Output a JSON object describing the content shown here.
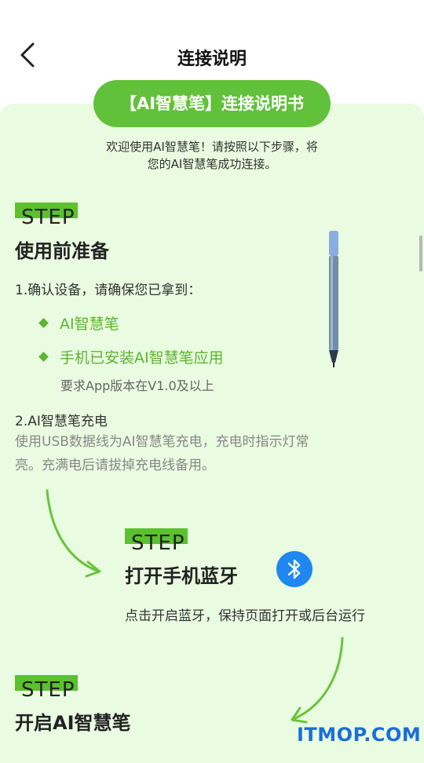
{
  "header": {
    "title": "连接说明"
  },
  "banner": {
    "label": "【AI智慧笔】连接说明书"
  },
  "intro": {
    "line1": "欢迎使用AI智慧笔！请按照以下步骤，将",
    "line2": "您的AI智慧笔成功连接。"
  },
  "step1": {
    "tag": "STEP",
    "title": "使用前准备",
    "item1": "1.确认设备，请确保您已拿到：",
    "bullet1": "AI智慧笔",
    "bullet2": "手机已安装AI智慧笔应用",
    "note": "要求App版本在V1.0及以上",
    "item2": "2.AI智慧笔充电",
    "desc_line1": "使用USB数据线为AI智慧笔充电，充电时指示灯常",
    "desc_line2": "亮。充满电后请拔掉充电线备用。"
  },
  "step2": {
    "tag": "STEP",
    "title": "打开手机蓝牙",
    "desc": "点击开启蓝牙，保持页面打开或后台运行"
  },
  "step3": {
    "tag": "STEP",
    "title": "开启AI智慧笔"
  },
  "watermark": "ITMOP.COM",
  "colors": {
    "accent": "#62c13a",
    "card_bg": "#e9fbe0",
    "bluetooth": "#1e88f0"
  },
  "icons": {
    "back": "chevron-left-icon",
    "bluetooth": "bluetooth-icon",
    "pen": "pen-illustration"
  }
}
